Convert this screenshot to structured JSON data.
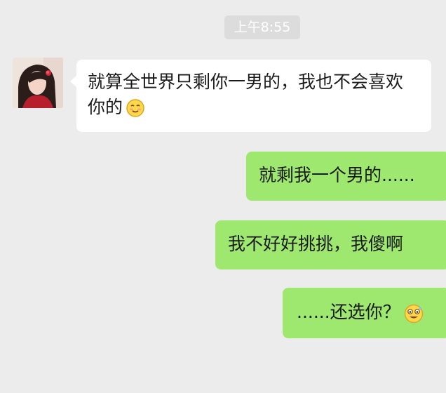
{
  "chat": {
    "timestamp": "上午8:55",
    "messages": [
      {
        "direction": "incoming",
        "text": "就算全世界只剩你一男的，我也不会喜欢你的",
        "emoji": "smiling-face-icon"
      },
      {
        "direction": "outgoing",
        "text": "就剩我一个男的......"
      },
      {
        "direction": "outgoing",
        "text": "我不好好挑挑，我傻啊"
      },
      {
        "direction": "outgoing",
        "text": "......还选你？",
        "emoji": "sweat-smile-face-icon"
      }
    ]
  },
  "colors": {
    "background": "#ececec",
    "incoming_bubble": "#ffffff",
    "outgoing_bubble": "#9ee870",
    "timestamp_bg": "#dcdcdc",
    "text": "#1a1a1a"
  }
}
